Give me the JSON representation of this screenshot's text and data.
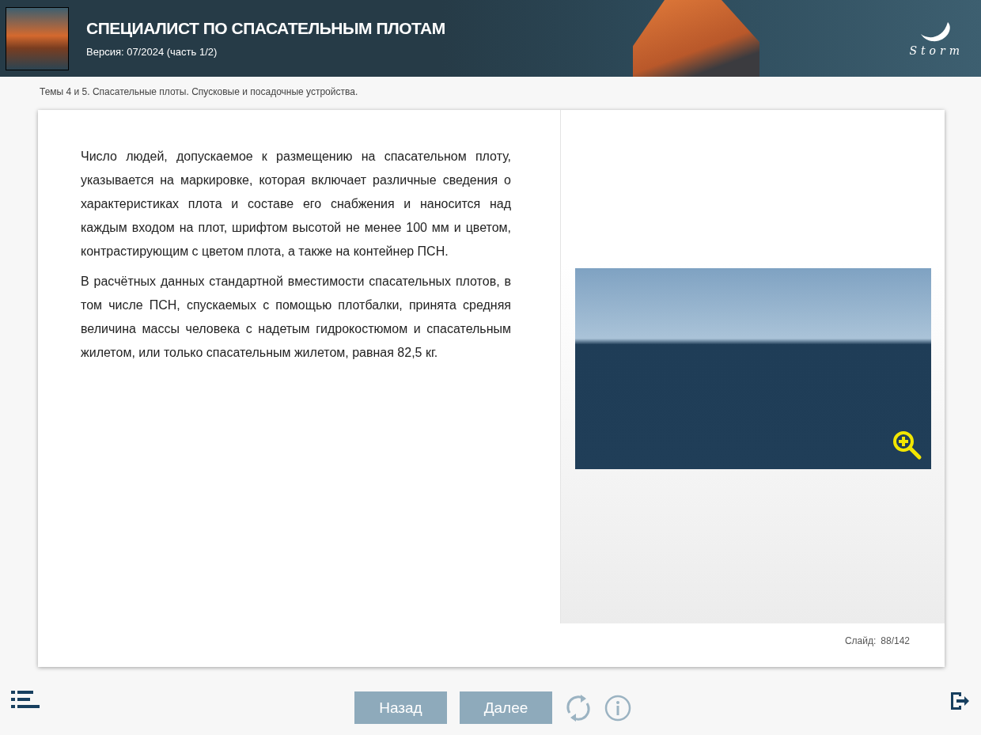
{
  "header": {
    "title": "СПЕЦИАЛИСТ ПО СПАСАТЕЛЬНЫМ ПЛОТАМ",
    "version": "Версия: 07/2024 (часть 1/2)",
    "logo_text": "Storm"
  },
  "breadcrumb": "Темы 4 и 5. Спасательные плоты. Спусковые и посадочные устройства.",
  "paragraphs": [
    "Число людей, допускаемое к размещению на спасательном плоту, указывается на маркировке, которая включает различные сведения о характеристиках плота и составе его снабжения и наносится над каждым входом на плот, шрифтом высотой не менее 100 мм и цветом, контрастирующим с цветом плота, а также на контейнер ПСН.",
    "В расчётных данных стандартной вместимости спасательных плотов, в том числе ПСН, спускаемых с помощью плотбалки, принята средняя величина массы человека с надетым гидрокостюмом и спасательным жилетом, или только спасательным жилетом, равная 82,5 кг."
  ],
  "slide_counter": {
    "label": "Слайд:",
    "value": "88/142"
  },
  "nav": {
    "back": "Назад",
    "next": "Далее"
  }
}
